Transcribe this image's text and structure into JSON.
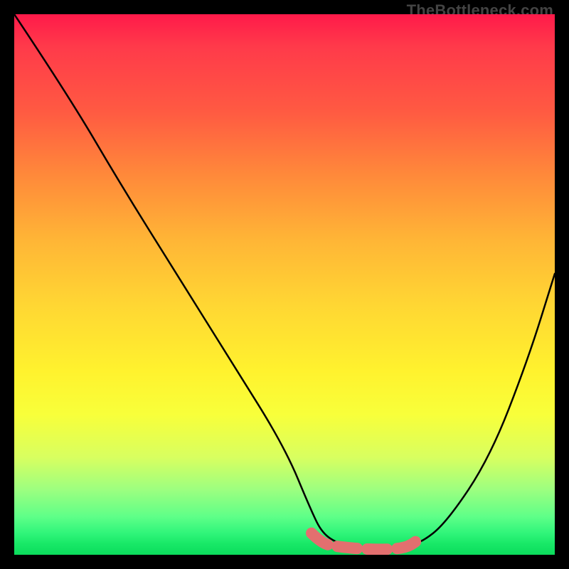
{
  "watermark": "TheBottleneck.com",
  "chart_data": {
    "type": "line",
    "title": "",
    "xlabel": "",
    "ylabel": "",
    "xlim": [
      0,
      100
    ],
    "ylim": [
      0,
      100
    ],
    "background_gradient": {
      "top": "#ff1a4a",
      "bottom": "#18e867",
      "meaning": "red = high bottleneck, green = low bottleneck"
    },
    "series": [
      {
        "name": "bottleneck-curve",
        "x": [
          0,
          10,
          20,
          30,
          40,
          50,
          55,
          57,
          60,
          65,
          70,
          75,
          80,
          88,
          95,
          100
        ],
        "values": [
          100,
          85,
          68,
          52,
          36,
          20,
          8,
          4,
          2,
          1,
          1,
          2,
          6,
          18,
          36,
          52
        ]
      },
      {
        "name": "flat-valley-highlight",
        "x": [
          55,
          57,
          60,
          65,
          70,
          73,
          75
        ],
        "values": [
          4,
          2,
          1.5,
          1,
          1,
          1.5,
          3
        ]
      }
    ],
    "annotations": []
  },
  "colors": {
    "curve": "#000000",
    "highlight": "#e36f6f"
  }
}
